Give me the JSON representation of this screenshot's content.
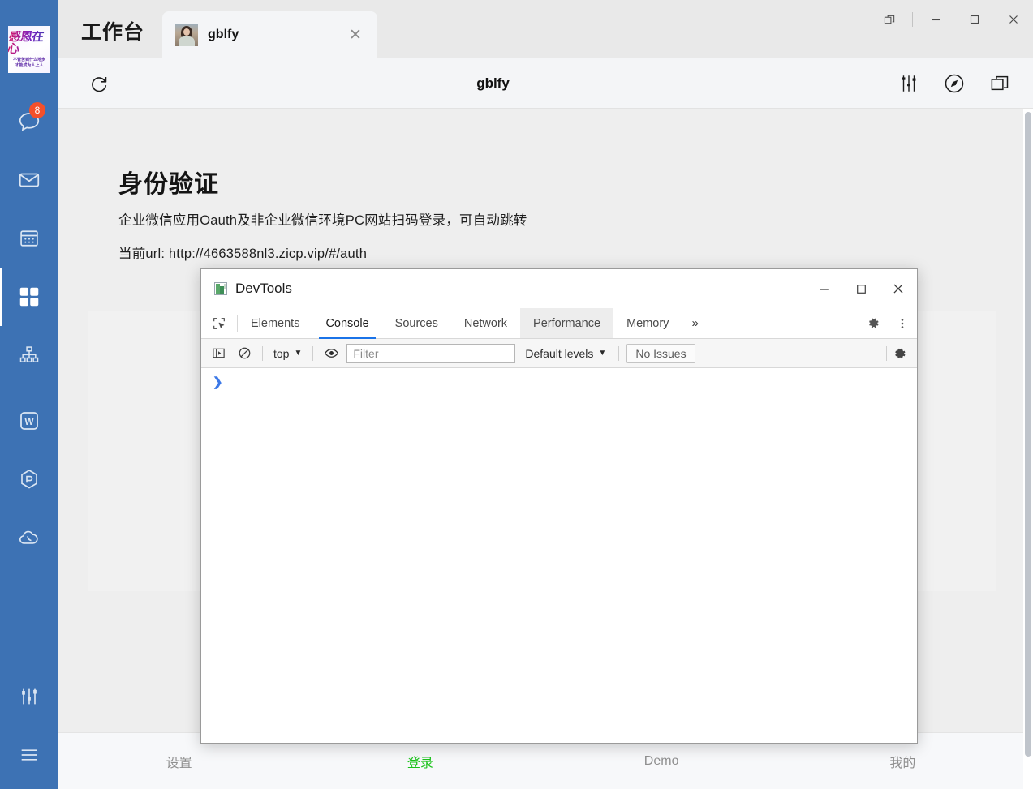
{
  "sidebar": {
    "logo": {
      "name": "brand-logo",
      "top_text": "感恩在心",
      "bottom_text": "不管苦到什么地步\n才能成为人上人"
    },
    "items": [
      {
        "icon": "chat-bubble-icon",
        "badge": "8",
        "active": false
      },
      {
        "icon": "mail-envelope-icon",
        "badge": "",
        "active": false
      },
      {
        "icon": "calendar-icon",
        "badge": "",
        "active": false
      },
      {
        "icon": "grid-apps-icon",
        "badge": "",
        "active": true
      },
      {
        "icon": "org-chart-icon",
        "badge": "",
        "active": false
      },
      {
        "icon": "w-document-icon",
        "badge": "",
        "active": false
      },
      {
        "icon": "cube-package-icon",
        "badge": "",
        "active": false
      },
      {
        "icon": "cloud-phone-icon",
        "badge": "",
        "active": false
      }
    ],
    "bottom_items": [
      {
        "icon": "sliders-settings-icon"
      },
      {
        "icon": "hamburger-menu-icon"
      }
    ],
    "accent_color": "#3d72b4"
  },
  "tabstrip": {
    "workbench_title": "工作台",
    "tab": {
      "title": "gblfy",
      "thumb": "user-avatar-thumbnail",
      "close_glyph": "✕"
    },
    "window_controls": {
      "restore_panel": "panel-restore-icon",
      "minimize": "—",
      "maximize": "▢",
      "close": "✕"
    }
  },
  "pagebar": {
    "reload_icon": "reload-icon",
    "title": "gblfy",
    "actions": [
      {
        "icon": "sliders-icon"
      },
      {
        "icon": "compass-icon"
      },
      {
        "icon": "open-external-icon"
      }
    ]
  },
  "webpage": {
    "heading": "身份验证",
    "paragraph1": "企业微信应用Oauth及非企业微信环境PC网站扫码登录，可自动跳转",
    "paragraph2": "当前url: http://4663588nl3.zicp.vip/#/auth",
    "bottom_nav": [
      {
        "label": "设置",
        "active": false
      },
      {
        "label": "登录",
        "active": true
      },
      {
        "label": "Demo",
        "active": false
      },
      {
        "label": "我的",
        "active": false
      }
    ],
    "active_nav_color": "#19c219"
  },
  "devtools": {
    "window_title": "DevTools",
    "app_icon": "devtools-app-icon",
    "window_controls": {
      "minimize": "—",
      "maximize": "▢",
      "close": "✕"
    },
    "inspect_icon": "inspect-element-icon",
    "tabs": [
      {
        "label": "Elements",
        "state": "normal"
      },
      {
        "label": "Console",
        "state": "selected"
      },
      {
        "label": "Sources",
        "state": "normal"
      },
      {
        "label": "Network",
        "state": "normal"
      },
      {
        "label": "Performance",
        "state": "hovered"
      },
      {
        "label": "Memory",
        "state": "normal"
      }
    ],
    "more_tabs_glyph": "»",
    "settings_icon": "gear-icon",
    "menu_icon": "kebab-menu-icon",
    "console_toolbar": {
      "sidebar_toggle_icon": "console-sidebar-toggle-icon",
      "clear_icon": "clear-console-icon",
      "context_label": "top",
      "context_caret": "▼",
      "eye_icon": "live-expression-eye-icon",
      "filter_placeholder": "Filter",
      "filter_value": "",
      "levels_label": "Default levels",
      "levels_caret": "▼",
      "issues_label": "No Issues",
      "settings_icon": "console-settings-gear-icon"
    },
    "console_prompt": "❯",
    "console_lines": []
  }
}
